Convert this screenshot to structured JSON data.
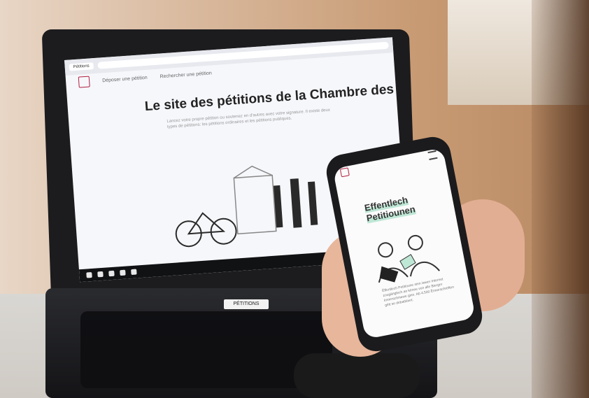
{
  "laptop": {
    "site_title": "Le site des pétitions de la Chambre des Députés",
    "subtitle": "Lancez votre propre pétition ou soutenez en d'autres avec votre signature. Il existe deux types de pétitions: les pétitions ordinaires et les pétitions publiques.",
    "nav": {
      "item1": "Déposer une pétition",
      "item2": "Rechercher une pétition"
    },
    "label": "PÉTITIONS"
  },
  "phone": {
    "title_line1": "Effentlech",
    "title_line2": "Petitiounen",
    "body": "Ëffentlech Petitioune sinn iwwer Internet zougänglech an kënne vun alle Bierger ënnerschriwwe ginn. Ab 4.500 Ënnerschrëften gëtt se debattéiert."
  },
  "colors": {
    "brand": "#b11f3f",
    "accent_green": "#bfe7d6"
  }
}
